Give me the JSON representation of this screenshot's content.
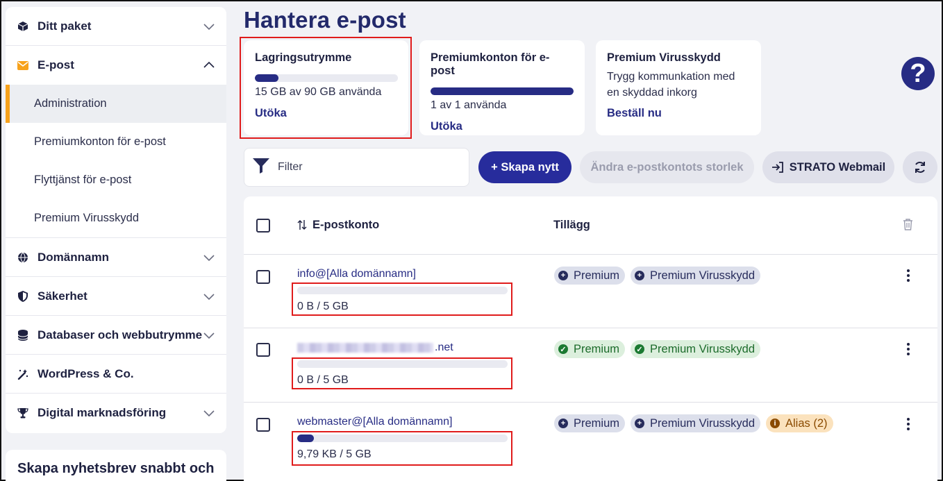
{
  "sidebar": {
    "items": [
      {
        "label": "Ditt paket",
        "icon": "box-icon"
      },
      {
        "label": "E-post",
        "icon": "envelope-icon",
        "expanded": true,
        "children": [
          "Administration",
          "Premiumkonton för e-post",
          "Flyttjänst för e-post",
          "Premium Virusskydd"
        ]
      },
      {
        "label": "Domännamn",
        "icon": "globe-icon"
      },
      {
        "label": "Säkerhet",
        "icon": "shield-icon"
      },
      {
        "label": "Databaser och webbutrymme",
        "icon": "database-icon"
      },
      {
        "label": "WordPress & Co.",
        "icon": "magic-wand-icon"
      },
      {
        "label": "Digital marknadsföring",
        "icon": "trophy-icon"
      }
    ],
    "promo_title": "Skapa nyhetsbrev snabbt och"
  },
  "page": {
    "title": "Hantera e-post"
  },
  "cards": {
    "storage": {
      "title": "Lagringsutrymme",
      "progress": 0.167,
      "usage": "15 GB av 90 GB använda",
      "link": "Utöka"
    },
    "premium": {
      "title": "Premiumkonton för e-post",
      "progress": 1.0,
      "usage": "1 av 1 använda",
      "link": "Utöka"
    },
    "virus": {
      "title": "Premium Virusskydd",
      "desc_line1": "Trygg kommunkation med",
      "desc_line2": "en skyddad inkorg",
      "link": "Beställ nu"
    }
  },
  "toolbar": {
    "filter_placeholder": "Filter",
    "create_label": "+ Skapa nytt",
    "resize_label": "Ändra e-postkontots storlek",
    "webmail_label": "STRATO Webmail"
  },
  "table": {
    "col_account": "E-postkonto",
    "col_addons": "Tillägg",
    "rows": [
      {
        "email": "info@[Alla domännamn]",
        "usage": "0 B / 5 GB",
        "progress": 0.0,
        "badges": [
          {
            "label": "Premium",
            "type": "info"
          },
          {
            "label": "Premium Virusskydd",
            "type": "info"
          }
        ]
      },
      {
        "email": "xxxxxxxxxxxx.net",
        "email_suffix": ".net",
        "usage": "0 B / 5 GB",
        "progress": 0.0,
        "badges": [
          {
            "label": "Premium",
            "type": "ok"
          },
          {
            "label": "Premium Virusskydd",
            "type": "ok"
          }
        ]
      },
      {
        "email": "webmaster@[Alla domännamn]",
        "usage": "9,79 KB / 5 GB",
        "progress": 0.08,
        "badges": [
          {
            "label": "Premium",
            "type": "info"
          },
          {
            "label": "Premium Virusskydd",
            "type": "info"
          },
          {
            "label": "Alias (2)",
            "type": "alias"
          }
        ]
      }
    ]
  },
  "colors": {
    "accent": "#272c84",
    "orange": "#f7a21b",
    "highlight": "#e01b1b"
  }
}
